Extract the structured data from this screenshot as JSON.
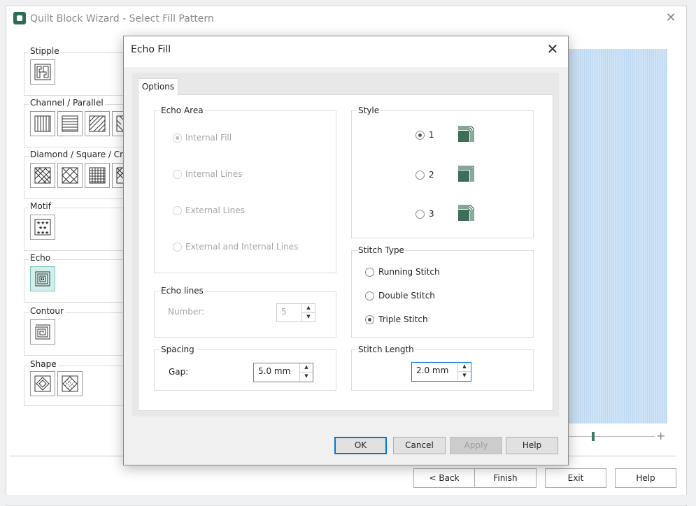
{
  "wizard": {
    "title": "Quilt Block Wizard - Select Fill Pattern",
    "close_glyph": "✕",
    "groups": [
      {
        "label": "Stipple",
        "patterns": [
          "stipple-pattern-icon"
        ]
      },
      {
        "label": "Channel / Parallel",
        "patterns": [
          "vertical-lines-icon",
          "horizontal-lines-icon",
          "diagonal-lines-icon",
          "diagonal-lines-alt-icon"
        ]
      },
      {
        "label": "Diamond / Square / Cro",
        "patterns": [
          "diamond-crosshatch-icon",
          "diamond-crosshatch-alt-icon",
          "square-grid-icon",
          "diamond-partial-icon"
        ]
      },
      {
        "label": "Motif",
        "patterns": [
          "star-motif-icon"
        ]
      },
      {
        "label": "Echo",
        "patterns": [
          "echo-squares-icon"
        ]
      },
      {
        "label": "Contour",
        "patterns": [
          "contour-spiral-icon"
        ]
      },
      {
        "label": "Shape",
        "patterns": [
          "diamond-shape-icon",
          "diamond-dots-icon"
        ]
      }
    ],
    "selected_pattern": "echo-squares-icon",
    "buttons": {
      "back": "< Back",
      "finish": "Finish",
      "exit": "Exit",
      "help": "Help"
    },
    "zoom_plus": "+",
    "zoom_level": 0.28
  },
  "dialog": {
    "title": "Echo Fill",
    "close_glyph": "✕",
    "tab_label": "Options",
    "echo_area": {
      "title": "Echo Area",
      "options": [
        "Internal Fill",
        "Internal Lines",
        "External Lines",
        "External and Internal Lines"
      ],
      "selected": "Internal Fill"
    },
    "echo_lines": {
      "title": "Echo lines",
      "number_label": "Number:",
      "number_value": "5"
    },
    "spacing": {
      "title": "Spacing",
      "gap_label": "Gap:",
      "gap_value": "5.0 mm"
    },
    "style": {
      "title": "Style",
      "options": [
        "1",
        "2",
        "3"
      ],
      "selected": "1"
    },
    "stitch_type": {
      "title": "Stitch Type",
      "options": [
        "Running Stitch",
        "Double Stitch",
        "Triple Stitch"
      ],
      "selected": "Triple Stitch"
    },
    "stitch_length": {
      "title": "Stitch Length",
      "value": "2.0 mm"
    },
    "buttons": {
      "ok": "OK",
      "cancel": "Cancel",
      "apply": "Apply",
      "help": "Help"
    }
  },
  "colors": {
    "accent": "#0078d7",
    "brand_green": "#2f6b55",
    "selected_fill": "#d3efec",
    "preview_blue": "#cfe3f6"
  }
}
